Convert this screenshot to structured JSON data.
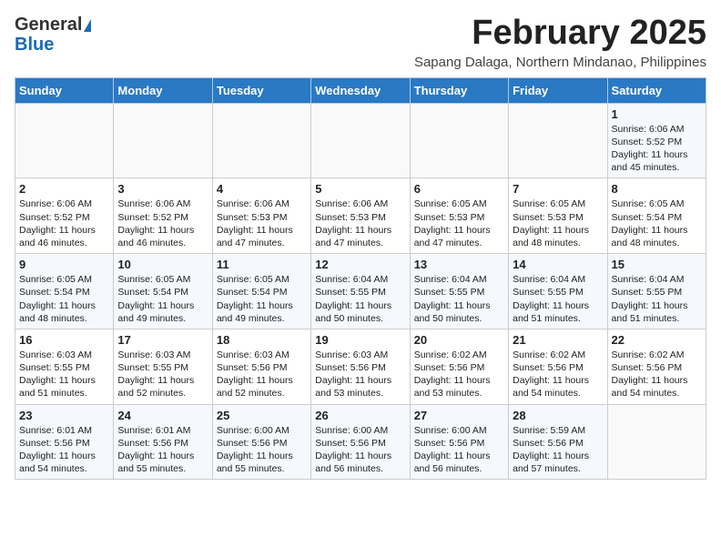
{
  "header": {
    "logo_line1": "General",
    "logo_line2": "Blue",
    "month_title": "February 2025",
    "location": "Sapang Dalaga, Northern Mindanao, Philippines"
  },
  "weekdays": [
    "Sunday",
    "Monday",
    "Tuesday",
    "Wednesday",
    "Thursday",
    "Friday",
    "Saturday"
  ],
  "weeks": [
    [
      {
        "day": "",
        "info": ""
      },
      {
        "day": "",
        "info": ""
      },
      {
        "day": "",
        "info": ""
      },
      {
        "day": "",
        "info": ""
      },
      {
        "day": "",
        "info": ""
      },
      {
        "day": "",
        "info": ""
      },
      {
        "day": "1",
        "info": "Sunrise: 6:06 AM\nSunset: 5:52 PM\nDaylight: 11 hours and 45 minutes."
      }
    ],
    [
      {
        "day": "2",
        "info": "Sunrise: 6:06 AM\nSunset: 5:52 PM\nDaylight: 11 hours and 46 minutes."
      },
      {
        "day": "3",
        "info": "Sunrise: 6:06 AM\nSunset: 5:52 PM\nDaylight: 11 hours and 46 minutes."
      },
      {
        "day": "4",
        "info": "Sunrise: 6:06 AM\nSunset: 5:53 PM\nDaylight: 11 hours and 47 minutes."
      },
      {
        "day": "5",
        "info": "Sunrise: 6:06 AM\nSunset: 5:53 PM\nDaylight: 11 hours and 47 minutes."
      },
      {
        "day": "6",
        "info": "Sunrise: 6:05 AM\nSunset: 5:53 PM\nDaylight: 11 hours and 47 minutes."
      },
      {
        "day": "7",
        "info": "Sunrise: 6:05 AM\nSunset: 5:53 PM\nDaylight: 11 hours and 48 minutes."
      },
      {
        "day": "8",
        "info": "Sunrise: 6:05 AM\nSunset: 5:54 PM\nDaylight: 11 hours and 48 minutes."
      }
    ],
    [
      {
        "day": "9",
        "info": "Sunrise: 6:05 AM\nSunset: 5:54 PM\nDaylight: 11 hours and 48 minutes."
      },
      {
        "day": "10",
        "info": "Sunrise: 6:05 AM\nSunset: 5:54 PM\nDaylight: 11 hours and 49 minutes."
      },
      {
        "day": "11",
        "info": "Sunrise: 6:05 AM\nSunset: 5:54 PM\nDaylight: 11 hours and 49 minutes."
      },
      {
        "day": "12",
        "info": "Sunrise: 6:04 AM\nSunset: 5:55 PM\nDaylight: 11 hours and 50 minutes."
      },
      {
        "day": "13",
        "info": "Sunrise: 6:04 AM\nSunset: 5:55 PM\nDaylight: 11 hours and 50 minutes."
      },
      {
        "day": "14",
        "info": "Sunrise: 6:04 AM\nSunset: 5:55 PM\nDaylight: 11 hours and 51 minutes."
      },
      {
        "day": "15",
        "info": "Sunrise: 6:04 AM\nSunset: 5:55 PM\nDaylight: 11 hours and 51 minutes."
      }
    ],
    [
      {
        "day": "16",
        "info": "Sunrise: 6:03 AM\nSunset: 5:55 PM\nDaylight: 11 hours and 51 minutes."
      },
      {
        "day": "17",
        "info": "Sunrise: 6:03 AM\nSunset: 5:55 PM\nDaylight: 11 hours and 52 minutes."
      },
      {
        "day": "18",
        "info": "Sunrise: 6:03 AM\nSunset: 5:56 PM\nDaylight: 11 hours and 52 minutes."
      },
      {
        "day": "19",
        "info": "Sunrise: 6:03 AM\nSunset: 5:56 PM\nDaylight: 11 hours and 53 minutes."
      },
      {
        "day": "20",
        "info": "Sunrise: 6:02 AM\nSunset: 5:56 PM\nDaylight: 11 hours and 53 minutes."
      },
      {
        "day": "21",
        "info": "Sunrise: 6:02 AM\nSunset: 5:56 PM\nDaylight: 11 hours and 54 minutes."
      },
      {
        "day": "22",
        "info": "Sunrise: 6:02 AM\nSunset: 5:56 PM\nDaylight: 11 hours and 54 minutes."
      }
    ],
    [
      {
        "day": "23",
        "info": "Sunrise: 6:01 AM\nSunset: 5:56 PM\nDaylight: 11 hours and 54 minutes."
      },
      {
        "day": "24",
        "info": "Sunrise: 6:01 AM\nSunset: 5:56 PM\nDaylight: 11 hours and 55 minutes."
      },
      {
        "day": "25",
        "info": "Sunrise: 6:00 AM\nSunset: 5:56 PM\nDaylight: 11 hours and 55 minutes."
      },
      {
        "day": "26",
        "info": "Sunrise: 6:00 AM\nSunset: 5:56 PM\nDaylight: 11 hours and 56 minutes."
      },
      {
        "day": "27",
        "info": "Sunrise: 6:00 AM\nSunset: 5:56 PM\nDaylight: 11 hours and 56 minutes."
      },
      {
        "day": "28",
        "info": "Sunrise: 5:59 AM\nSunset: 5:56 PM\nDaylight: 11 hours and 57 minutes."
      },
      {
        "day": "",
        "info": ""
      }
    ]
  ]
}
